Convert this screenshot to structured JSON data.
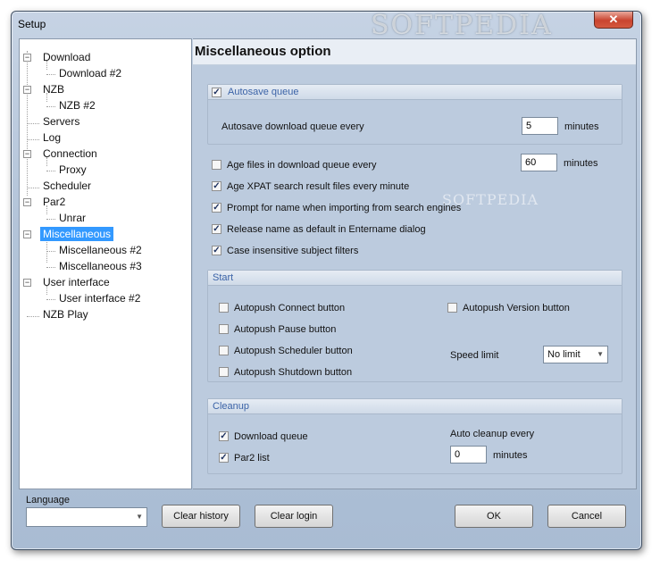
{
  "window": {
    "title": "Setup",
    "watermark": "SOFTPEDIA",
    "close_glyph": "✕"
  },
  "tree": {
    "items": [
      {
        "label": "Download"
      },
      {
        "label": "Download #2"
      },
      {
        "label": "NZB"
      },
      {
        "label": "NZB #2"
      },
      {
        "label": "Servers"
      },
      {
        "label": "Log"
      },
      {
        "label": "Connection"
      },
      {
        "label": "Proxy"
      },
      {
        "label": "Scheduler"
      },
      {
        "label": "Par2"
      },
      {
        "label": "Unrar"
      },
      {
        "label": "Miscellaneous"
      },
      {
        "label": "Miscellaneous #2"
      },
      {
        "label": "Miscellaneous #3"
      },
      {
        "label": "User interface"
      },
      {
        "label": "User interface #2"
      },
      {
        "label": "NZB Play"
      }
    ],
    "selected": "Miscellaneous"
  },
  "main": {
    "title": "Miscellaneous option",
    "watermark": "SOFTPEDIA",
    "autosave": {
      "header": "Autosave queue",
      "checked": true,
      "every_label": "Autosave download queue every",
      "every_value": "5",
      "unit": "minutes"
    },
    "age_files": {
      "label": "Age files in download queue every",
      "checked": false,
      "value": "60",
      "unit": "minutes"
    },
    "options": [
      {
        "label": "Age XPAT search result files every minute",
        "checked": true
      },
      {
        "label": "Prompt for name when importing from search engines",
        "checked": true
      },
      {
        "label": "Release name as default in Entername dialog",
        "checked": true
      },
      {
        "label": "Case insensitive subject filters",
        "checked": true
      }
    ],
    "start": {
      "header": "Start",
      "connect": {
        "label": "Autopush Connect button",
        "checked": false
      },
      "pause": {
        "label": "Autopush Pause button",
        "checked": false
      },
      "scheduler": {
        "label": "Autopush Scheduler button",
        "checked": false
      },
      "shutdown": {
        "label": "Autopush Shutdown button",
        "checked": false
      },
      "version": {
        "label": "Autopush Version button",
        "checked": false
      },
      "speed_limit_label": "Speed limit",
      "speed_limit_value": "No limit"
    },
    "cleanup": {
      "header": "Cleanup",
      "download_queue": {
        "label": "Download queue",
        "checked": true
      },
      "par2": {
        "label": "Par2 list",
        "checked": true
      },
      "auto_label": "Auto cleanup every",
      "auto_value": "0",
      "unit": "minutes"
    }
  },
  "bottom": {
    "language_label": "Language",
    "language_value": "",
    "clear_history": "Clear history",
    "clear_login": "Clear login",
    "ok": "OK",
    "cancel": "Cancel"
  },
  "glyphs": {
    "check": "✓",
    "minus": "−",
    "dropdown": "▼"
  }
}
